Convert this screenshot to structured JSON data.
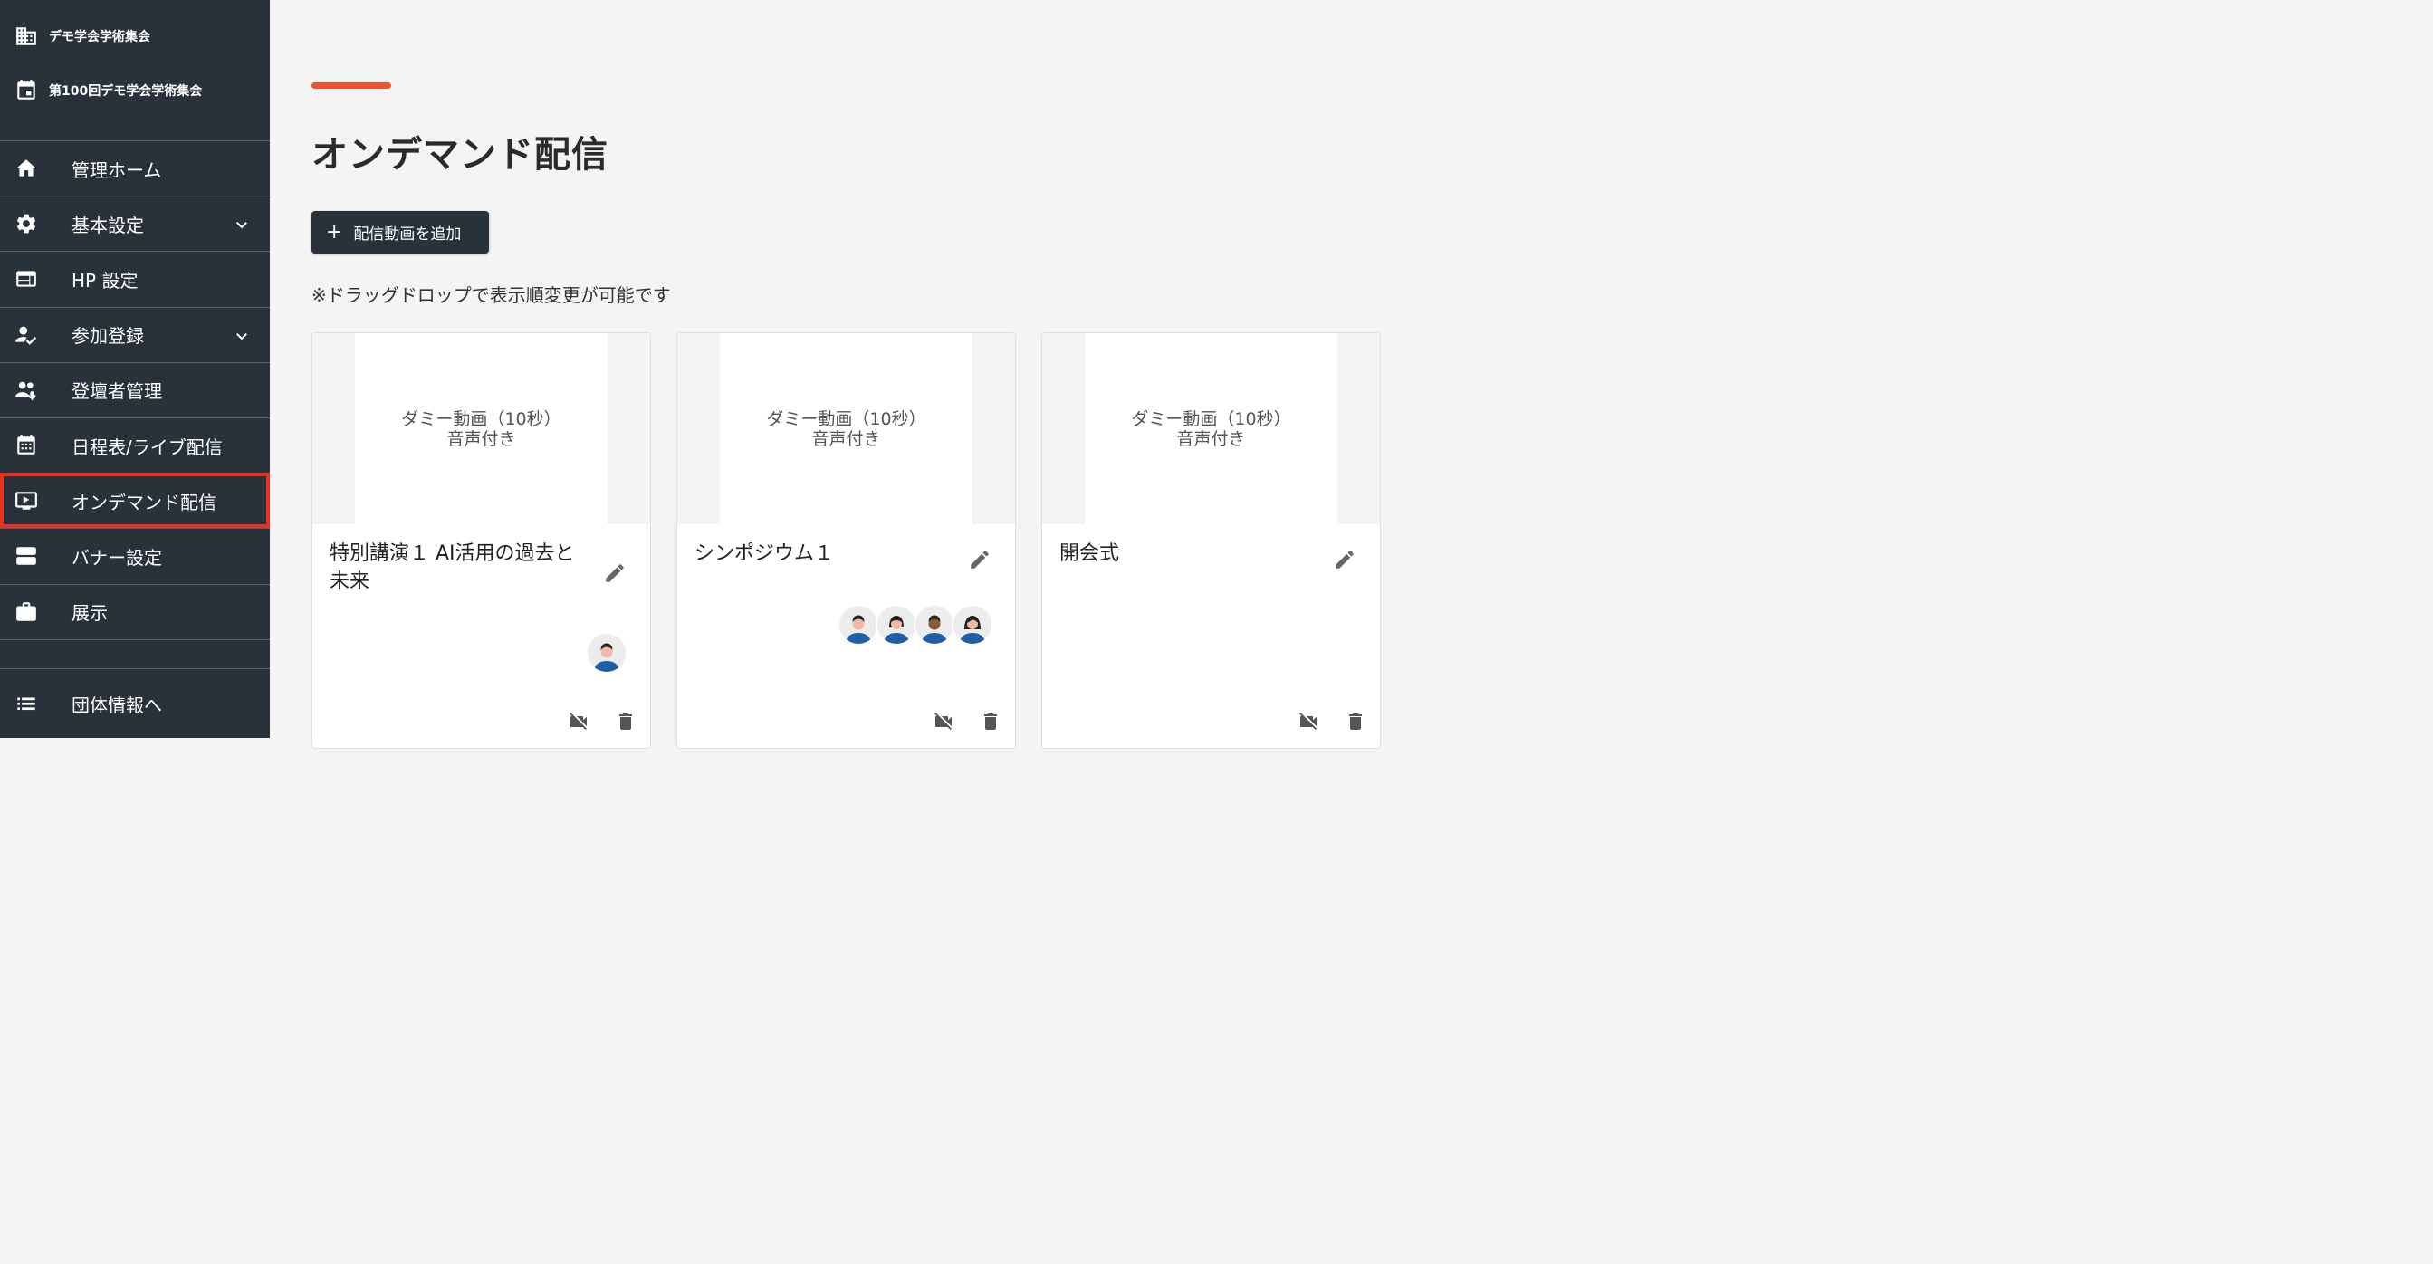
{
  "sidebar": {
    "org_name": "デモ学会学術集会",
    "event_name": "第100回デモ学会学術集会",
    "items": [
      {
        "label": "管理ホーム",
        "icon": "home-icon"
      },
      {
        "label": "基本設定",
        "icon": "gear-icon"
      },
      {
        "label": "HP 設定",
        "icon": "web-layout-icon"
      },
      {
        "label": "参加登録",
        "icon": "person-check-icon"
      },
      {
        "label": "登壇者管理",
        "icon": "speakers-icon"
      },
      {
        "label": "日程表/ライブ配信",
        "icon": "calendar-icon"
      },
      {
        "label": "オンデマンド配信",
        "icon": "play-screen-icon"
      },
      {
        "label": "バナー設定",
        "icon": "banner-icon"
      },
      {
        "label": "展示",
        "icon": "briefcase-icon"
      }
    ],
    "footer_label": "団体情報へ"
  },
  "main": {
    "title": "オンデマンド配信",
    "add_button": "配信動画を追加",
    "hint": "※ドラッグドロップで表示順変更が可能です"
  },
  "cards": [
    {
      "thumb_line1": "ダミー動画（10秒）",
      "thumb_line2": "音声付き",
      "title": "特別講演１ AI活用の過去と未来"
    },
    {
      "thumb_line1": "ダミー動画（10秒）",
      "thumb_line2": "音声付き",
      "title": "シンポジウム１"
    },
    {
      "thumb_line1": "ダミー動画（10秒）",
      "thumb_line2": "音声付き",
      "title": "開会式"
    }
  ],
  "colors": {
    "sidebar_bg": "#29323a",
    "accent": "#f0532b",
    "active_outline": "#e8321f",
    "avatar_shirt": "#1f5fa8"
  }
}
